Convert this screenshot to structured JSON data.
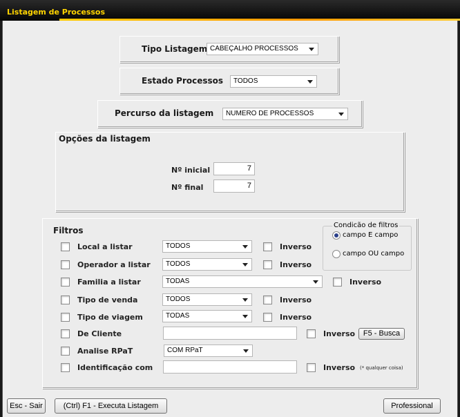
{
  "window": {
    "title": "Listagem de Processos"
  },
  "tipo_listagem": {
    "label": "Tipo Listagem",
    "value": "CABEÇALHO PROCESSOS"
  },
  "estado_processos": {
    "label": "Estado Processos",
    "value": "TODOS"
  },
  "percurso": {
    "label": "Percurso da listagem",
    "value": "NUMERO DE PROCESSOS"
  },
  "opcoes": {
    "title": "Opções da listagem",
    "inicial_label": "Nº inicial",
    "inicial_value": "7",
    "final_label": "Nº final",
    "final_value": "7"
  },
  "filtros": {
    "title": "Filtros",
    "condicao": {
      "title": "Condicão de filtros",
      "opt_e": "campo E campo",
      "opt_ou": "campo OU campo",
      "selected": "campo E campo"
    },
    "rows": {
      "local": {
        "label": "Local a listar",
        "value": "TODOS",
        "inverso": "Inverso"
      },
      "operador": {
        "label": "Operador a listar",
        "value": "TODOS",
        "inverso": "Inverso"
      },
      "familia": {
        "label": "Familia a listar",
        "value": "TODAS",
        "inverso": "Inverso"
      },
      "tipo_venda": {
        "label": "Tipo de venda",
        "value": "TODOS",
        "inverso": "Inverso"
      },
      "tipo_viagem": {
        "label": "Tipo de viagem",
        "value": "TODAS",
        "inverso": "Inverso"
      },
      "cliente": {
        "label": "De Cliente",
        "value": "",
        "inverso": "Inverso",
        "button": "F5 - Busca"
      },
      "rpat": {
        "label": "Analise RPaT",
        "value": "COM RPaT"
      },
      "identificacao": {
        "label": "Identificação com",
        "value": "",
        "inverso": "Inverso",
        "note": "(* qualquer coisa)"
      }
    }
  },
  "buttons": {
    "sair": "Esc - Sair",
    "executa": "(Ctrl) F1 - Executa Listagem",
    "professional": "Professional"
  }
}
